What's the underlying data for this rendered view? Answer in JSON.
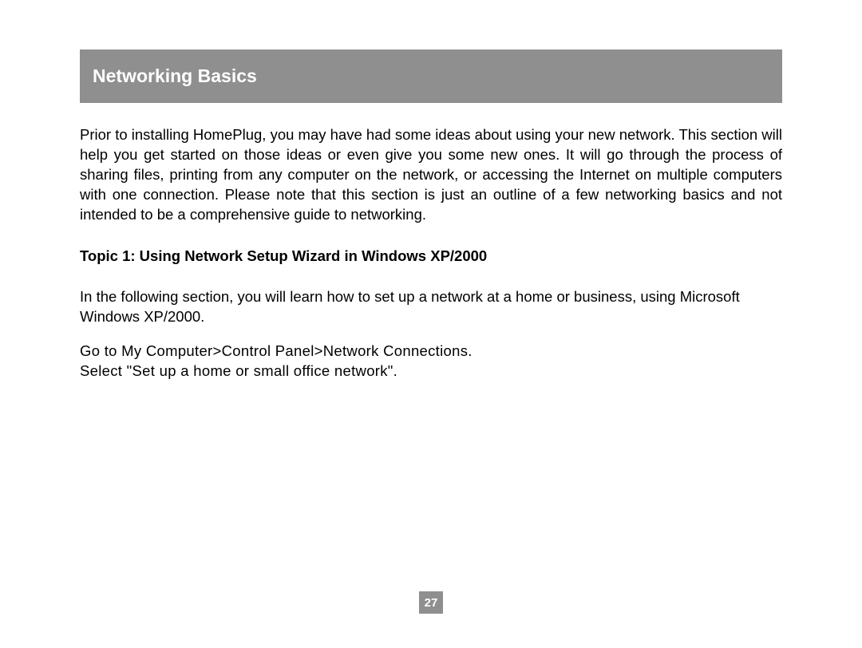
{
  "header": {
    "title": "Networking Basics"
  },
  "body": {
    "intro": "Prior to installing HomePlug, you may have had some ideas about using your new network.  This section will help you get started on those ideas or even give you some new ones.  It will go through the process of sharing files, printing from any computer on the network, or accessing the Internet on multiple computers with one connection.  Please note that this section is just an outline of a few networking basics and not intended to be a comprehensive guide to networking.",
    "topic_title": "Topic 1: Using Network Setup Wizard in Windows XP/2000",
    "topic_intro": "In the following section, you will learn how to set up a network at a home or business, using Microsoft Windows XP/2000.",
    "instructions": "Go to My Computer>Control Panel>Network Connections.\nSelect \"Set up a home or small office network\"."
  },
  "footer": {
    "page_number": "27"
  }
}
